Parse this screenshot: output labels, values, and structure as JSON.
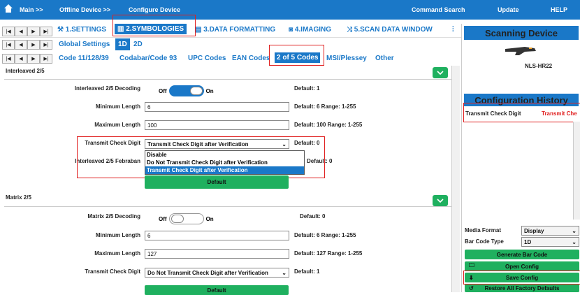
{
  "topbar": {
    "main": "Main >>",
    "offline": "Offline Device >>",
    "configure": "Configure Device",
    "command_search": "Command Search",
    "update": "Update",
    "help": "HELP"
  },
  "main_tabs": [
    "1.SETTINGS",
    "2.SYMBOLOGIES",
    "3.DATA FORMATTING",
    "4.IMAGING",
    "5.SCAN DATA WINDOW"
  ],
  "global_settings": "Global Settings",
  "dim_tabs": [
    "1D",
    "2D"
  ],
  "code_tabs": [
    "Code 11/128/39",
    "Codabar/Code 93",
    "UPC Codes",
    "EAN Codes",
    "2 of 5 Codes",
    "MSI/Plessey",
    "Other"
  ],
  "interleaved": {
    "title": "Interleaved 2/5",
    "decoding_label": "Interleaved 2/5 Decoding",
    "off": "Off",
    "on": "On",
    "decoding_state": "On",
    "decoding_default": "Default: 1",
    "min_label": "Minimum Length",
    "min_value": "6",
    "min_default": "Default: 6  Range: 1-255",
    "max_label": "Maximum Length",
    "max_value": "100",
    "max_default": "Default: 100  Range: 1-255",
    "check_label": "Transmit Check Digit",
    "check_value": "Transmit Check Digit after Verification",
    "check_default": "Default: 0",
    "options": [
      "Disable",
      "Do Not Transmit Check Digit after Verification",
      "Transmit Check Digit after Verification"
    ],
    "febraban_label": "Interleaved 2/5 Febraban",
    "febraban_default": "Default: 0",
    "default_btn": "Default"
  },
  "matrix": {
    "title": "Matrix 2/5",
    "decoding_label": "Matrix 2/5 Decoding",
    "off": "Off",
    "on": "On",
    "decoding_state": "Off",
    "decoding_default": "Default: 0",
    "min_label": "Minimum Length",
    "min_value": "6",
    "min_default": "Default: 6  Range: 1-255",
    "max_label": "Maximum Length",
    "max_value": "127",
    "max_default": "Default: 127  Range: 1-255",
    "check_label": "Transmit Check Digit",
    "check_value": "Do Not Transmit Check Digit after Verification",
    "check_default": "Default: 1",
    "default_btn": "Default"
  },
  "right_panel": {
    "scanning_device": "Scanning Device",
    "device_model": "NLS-HR22",
    "config_history": "Configuration History",
    "history_key": "Transmit Check Digit",
    "history_value": "Transmit Che",
    "media_format_label": "Media Format",
    "media_format_value": "Display",
    "bar_code_type_label": "Bar Code Type",
    "bar_code_type_value": "1D",
    "generate": "Generate Bar Code",
    "open_config": "Open Config",
    "save_config": "Save Config",
    "restore": "Restore All Factory Defaults"
  },
  "colors": {
    "accent": "#1a78c8",
    "green": "#1fb05f",
    "highlight": "#e02020"
  }
}
